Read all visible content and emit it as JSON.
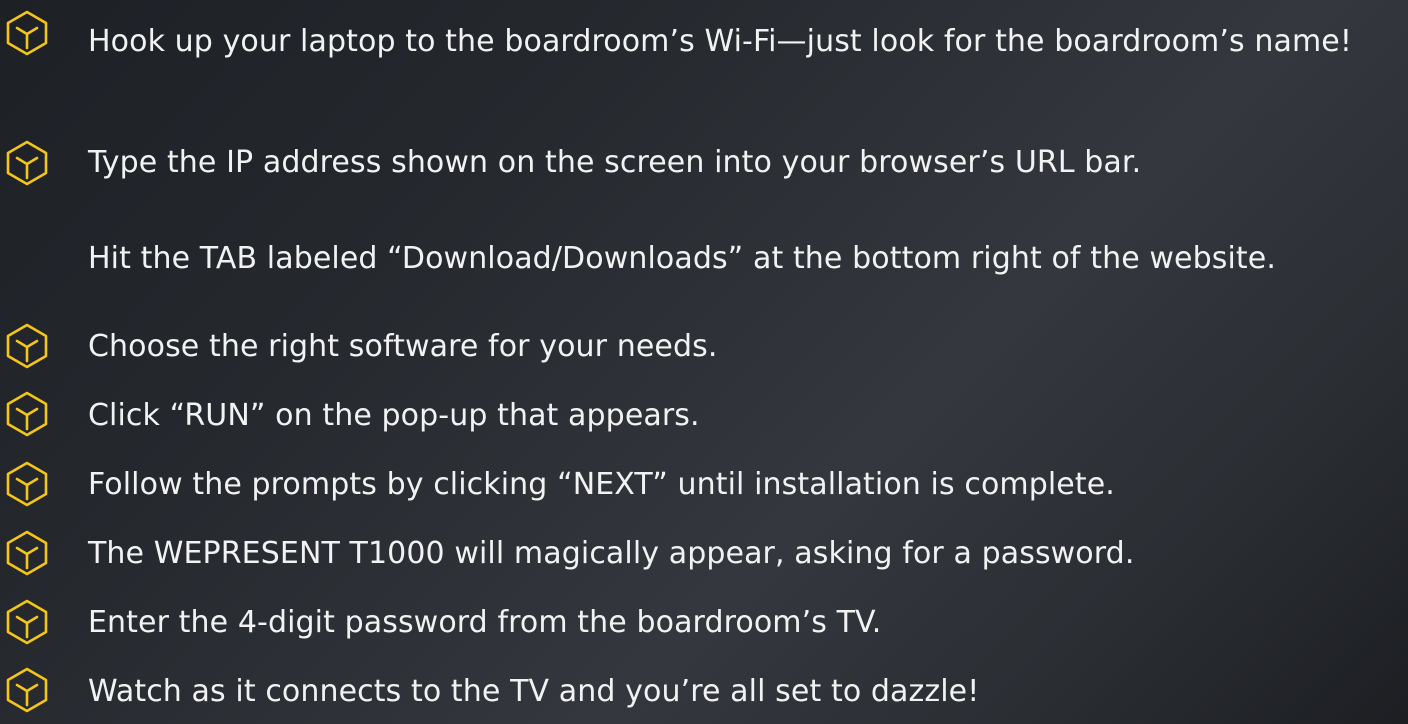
{
  "accent_color": "#f5c518",
  "steps": [
    {
      "text": "Hook up your laptop to the boardroom’s Wi-Fi—just look for the boardroom’s name!",
      "icon": "hexagon-icon"
    },
    {
      "text": "Type the IP address shown on the screen into your browser’s URL bar.",
      "icon": "hexagon-icon"
    },
    {
      "text": "Hit the TAB labeled “Download/Downloads” at the bottom right of the website.",
      "icon": ""
    },
    {
      "text": "Choose the right software for your needs.",
      "icon": "hexagon-icon"
    },
    {
      "text": "Click “RUN” on the pop-up that appears.",
      "icon": "hexagon-icon"
    },
    {
      "text": "Follow the prompts by clicking “NEXT” until installation is complete.",
      "icon": "hexagon-icon"
    },
    {
      "text": "The WEPRESENT T1000 will magically appear, asking for a password.",
      "icon": "hexagon-icon"
    },
    {
      "text": "Enter the 4-digit password from the boardroom’s TV.",
      "icon": "hexagon-icon"
    },
    {
      "text": "Watch as it connects to the TV and you’re all set to dazzle!",
      "icon": "hexagon-icon"
    }
  ]
}
